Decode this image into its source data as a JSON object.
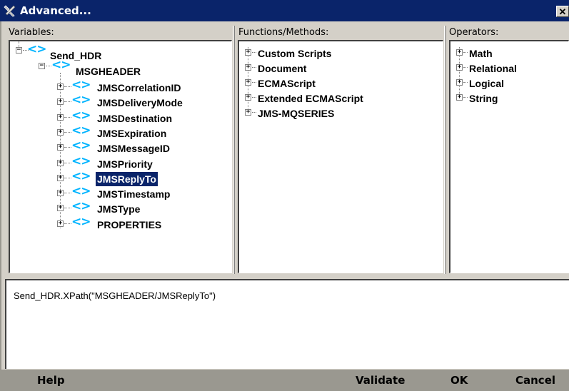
{
  "window": {
    "title": "Advanced...",
    "close_glyph": "✕"
  },
  "panels": {
    "variables_label": "Variables:",
    "functions_label": "Functions/Methods:",
    "operators_label": "Operators:"
  },
  "variables": {
    "root": "Send_HDR",
    "group": "MSGHEADER",
    "items": [
      "JMSCorrelationID",
      "JMSDeliveryMode",
      "JMSDestination",
      "JMSExpiration",
      "JMSMessageID",
      "JMSPriority",
      "JMSReplyTo",
      "JMSTimestamp",
      "JMSType",
      "PROPERTIES"
    ],
    "selected": "JMSReplyTo"
  },
  "functions": [
    "Custom Scripts",
    "Document",
    "ECMAScript",
    "Extended ECMAScript",
    "JMS-MQSERIES"
  ],
  "operators": [
    "Math",
    "Relational",
    "Logical",
    "String"
  ],
  "expression": "Send_HDR.XPath(\"MSGHEADER/JMSReplyTo\")",
  "buttons": {
    "help": "Help",
    "validate": "Validate",
    "ok": "OK",
    "cancel": "Cancel"
  },
  "icons": {
    "window": "tools-icon",
    "xml": "xml-element-icon"
  },
  "colors": {
    "titlebar": "#0a246a",
    "selection": "#0a246a",
    "xml_icon": "#00b4ff",
    "chrome": "#d4d0c8"
  }
}
